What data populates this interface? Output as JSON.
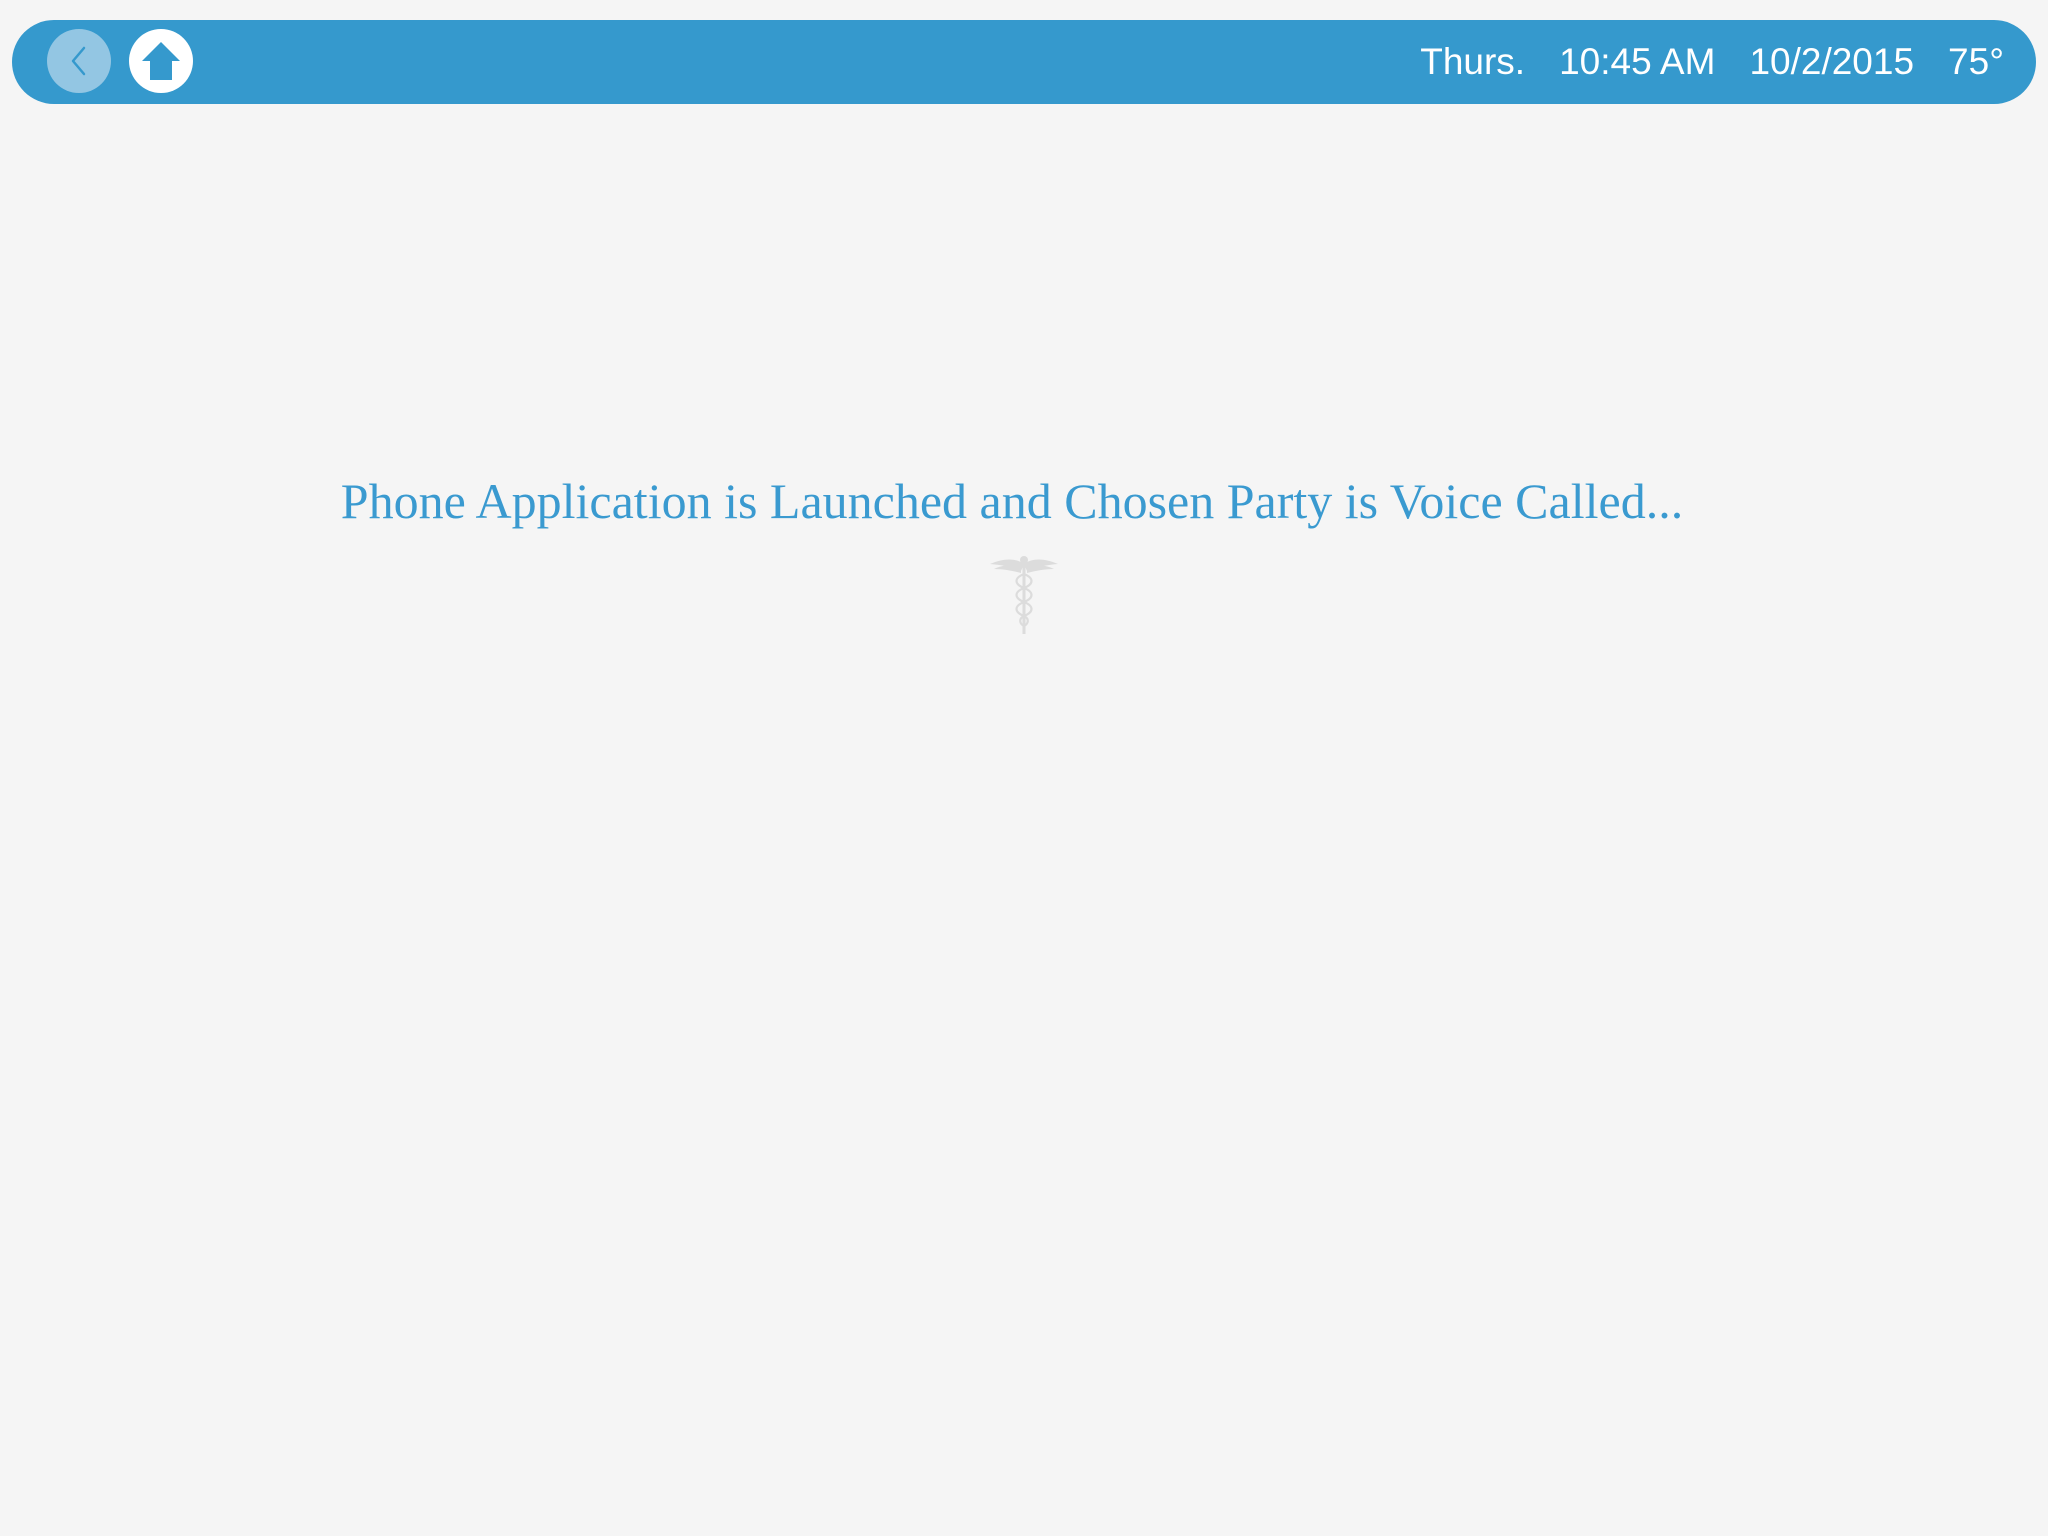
{
  "header": {
    "back_icon": "chevron-left-icon",
    "home_icon": "home-icon",
    "day": "Thurs.",
    "time": "10:45 AM",
    "date": "10/2/2015",
    "temperature": "75°"
  },
  "main": {
    "message": "Phone Application is Launched and Chosen Party is Voice Called...",
    "emblem_icon": "caduceus-icon"
  },
  "colors": {
    "header_bg": "#3599cd",
    "back_button_bg": "#93c6e3",
    "message_text": "#3a9ad0",
    "page_bg": "#f5f5f5"
  }
}
